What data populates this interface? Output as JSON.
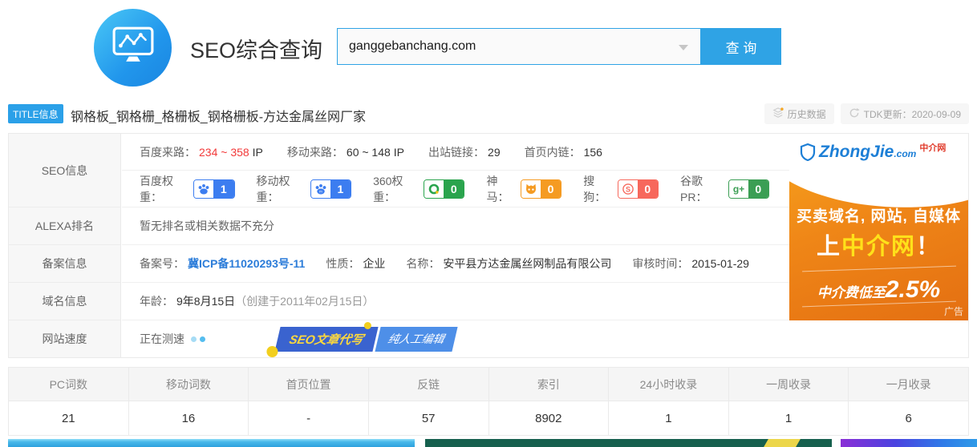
{
  "colors": {
    "accent_blue": "#2fa3e5",
    "badge_blue": "#3c7df0",
    "badge_green": "#2aa44d",
    "badge_orange": "#f59b22",
    "badge_red": "#f7685c",
    "badge_pr_green": "#3b9e54",
    "link_blue": "#2b7cd9",
    "red_text": "#f23a3a",
    "ad_orange": "#ef8617"
  },
  "header": {
    "title": "SEO综合查询",
    "search_value": "ganggebanchang.com",
    "search_button": "查 询"
  },
  "title_bar": {
    "badge": "TITLE信息",
    "title": "钢格板_钢格栅_格栅板_钢格栅板-方达金属丝网厂家",
    "history": "历史数据",
    "tdk": "TDK更新：2020-09-09"
  },
  "seo": {
    "row_label": "SEO信息",
    "traffic": [
      {
        "label": "百度来路：",
        "value": "234 ~ 358",
        "unit": "IP"
      },
      {
        "label": "移动来路：",
        "value": "60 ~ 148",
        "unit": "IP"
      },
      {
        "label": "出站链接：",
        "value": "29",
        "unit": ""
      },
      {
        "label": "首页内链：",
        "value": "156",
        "unit": ""
      }
    ],
    "weights": [
      {
        "label": "百度权重：",
        "value": "1"
      },
      {
        "label": "移动权重：",
        "value": "1"
      },
      {
        "label": "360权重：",
        "value": "0"
      },
      {
        "label": "神马：",
        "value": "0"
      },
      {
        "label": "搜狗：",
        "value": "0"
      },
      {
        "label": "谷歌PR：",
        "value": "0"
      }
    ]
  },
  "alexa": {
    "row_label": "ALEXA排名",
    "text": "暂无排名或相关数据不充分"
  },
  "beian": {
    "row_label": "备案信息",
    "num_label": "备案号：",
    "num": "冀ICP备11020293号-11",
    "nature_label": "性质：",
    "nature": "企业",
    "name_label": "名称：",
    "name": "安平县方达金属丝网制品有限公司",
    "time_label": "审核时间：",
    "time": "2015-01-29"
  },
  "domain": {
    "row_label": "域名信息",
    "age_label": "年龄：",
    "age": "9年8月15日",
    "created": "（创建于2011年02月15日）"
  },
  "speed": {
    "row_label": "网站速度",
    "status": "正在测速",
    "banner_left": "SEO文章代写",
    "banner_right": "纯人工编辑"
  },
  "ad": {
    "logo_main": "ZhongJie",
    "logo_com": ".com",
    "logo_cn": "中介网",
    "line1": "买卖域名, 网站, 自媒体",
    "line2_pre": "上",
    "line2_hl": "中介网",
    "line2_post": "！",
    "line3_label": "中介费低至",
    "line3_value": "2.5%",
    "tag": "广告"
  },
  "stats": {
    "cols": [
      {
        "label": "PC词数",
        "value": "21"
      },
      {
        "label": "移动词数",
        "value": "16"
      },
      {
        "label": "首页位置",
        "value": "-"
      },
      {
        "label": "反链",
        "value": "57"
      },
      {
        "label": "索引",
        "value": "8902"
      },
      {
        "label": "24小时收录",
        "value": "1"
      },
      {
        "label": "一周收录",
        "value": "1"
      },
      {
        "label": "一月收录",
        "value": "6"
      }
    ]
  }
}
